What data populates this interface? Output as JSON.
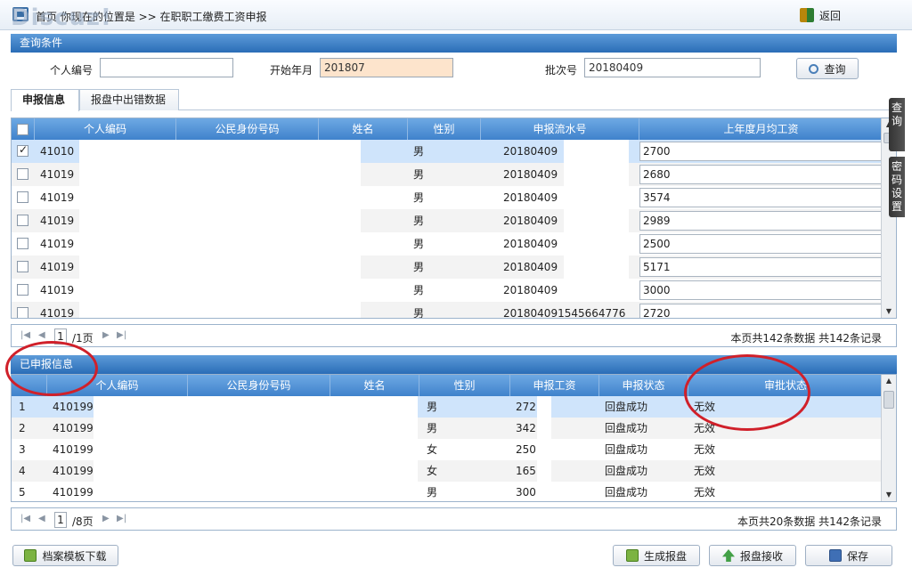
{
  "watermark": "Discuz!",
  "breadcrumb": "首页  你现在的位置是 >> 在职职工缴费工资申报",
  "back_label": "返回",
  "query": {
    "header": "查询条件",
    "personal_id_label": "个人编号",
    "personal_id_value": "",
    "start_month_label": "开始年月",
    "start_month_value": "201807",
    "batch_label": "批次号",
    "batch_value": "20180409",
    "search_label": "查询"
  },
  "tabs": [
    "申报信息",
    "报盘中出错数据"
  ],
  "top_grid": {
    "columns": [
      "个人编码",
      "公民身份号码",
      "姓名",
      "性别",
      "申报流水号",
      "上年度月均工资"
    ],
    "rows": [
      {
        "id": "41010",
        "gender": "男",
        "serial": "20180409",
        "salary": "2700",
        "checked": true
      },
      {
        "id": "41019",
        "gender": "男",
        "serial": "20180409",
        "salary": "2680",
        "checked": false
      },
      {
        "id": "41019",
        "gender": "男",
        "serial": "20180409",
        "salary": "3574",
        "checked": false
      },
      {
        "id": "41019",
        "gender": "男",
        "serial": "20180409",
        "salary": "2989",
        "checked": false
      },
      {
        "id": "41019",
        "gender": "男",
        "serial": "20180409",
        "salary": "2500",
        "checked": false
      },
      {
        "id": "41019",
        "gender": "男",
        "serial": "20180409",
        "salary": "5171",
        "checked": false
      },
      {
        "id": "41019",
        "gender": "男",
        "serial": "20180409",
        "salary": "3000",
        "checked": false
      },
      {
        "id": "41019",
        "gender": "男",
        "serial": "201804091545664776",
        "salary": "2720",
        "checked": false
      }
    ],
    "pager": {
      "page": "1",
      "total_pages": "/1页",
      "info": "本页共142条数据 共142条记录"
    }
  },
  "bottom_grid": {
    "header": "已申报信息",
    "columns": [
      "个人编码",
      "公民身份号码",
      "姓名",
      "性别",
      "申报工资",
      "申报状态",
      "审批状态"
    ],
    "rows": [
      {
        "no": "1",
        "id": "410199",
        "gender": "男",
        "wage": "272",
        "declare": "回盘成功",
        "approval": "无效"
      },
      {
        "no": "2",
        "id": "410199",
        "gender": "男",
        "wage": "342",
        "declare": "回盘成功",
        "approval": "无效"
      },
      {
        "no": "3",
        "id": "410199",
        "gender": "女",
        "wage": "250",
        "declare": "回盘成功",
        "approval": "无效"
      },
      {
        "no": "4",
        "id": "410199",
        "gender": "女",
        "wage": "165",
        "declare": "回盘成功",
        "approval": "无效"
      },
      {
        "no": "5",
        "id": "410199",
        "gender": "男",
        "wage": "300",
        "declare": "回盘成功",
        "approval": "无效"
      }
    ],
    "pager": {
      "page": "1",
      "total_pages": "/8页",
      "info": "本页共20条数据 共142条记录"
    }
  },
  "side_tabs": [
    "查询",
    "密码设置"
  ],
  "buttons": {
    "download": "档案模板下载",
    "generate": "生成报盘",
    "receive": "报盘接收",
    "save": "保存"
  },
  "colors": {
    "header_blue": "#2a6db7",
    "annotation_red": "#d0202a",
    "start_month_bg": "#fde4cc"
  }
}
